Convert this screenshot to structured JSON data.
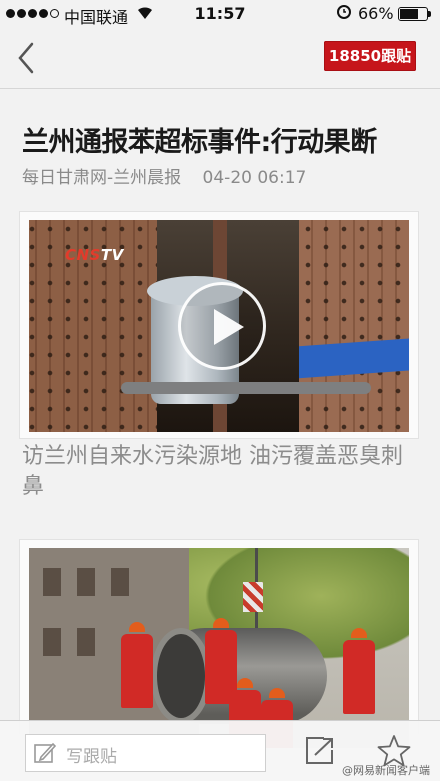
{
  "status_bar": {
    "carrier": "中国联通",
    "time": "11:57",
    "battery": "66%"
  },
  "nav": {
    "comment_count_label": "18850跟贴"
  },
  "article": {
    "title": "兰州通报苯超标事件:行动果断",
    "source": "每日甘肃网-兰州晨报",
    "date": "04-20 06:17"
  },
  "media": [
    {
      "type": "video",
      "channel_logo": "CNSTV",
      "caption": "访兰州自来水污染源地 油污覆盖恶臭刺鼻"
    },
    {
      "type": "photo"
    }
  ],
  "toolbar": {
    "reply_placeholder": "写跟贴",
    "share_icon": "share-icon",
    "favorite_icon": "star-icon"
  },
  "watermark": "@网易新闻客户端"
}
